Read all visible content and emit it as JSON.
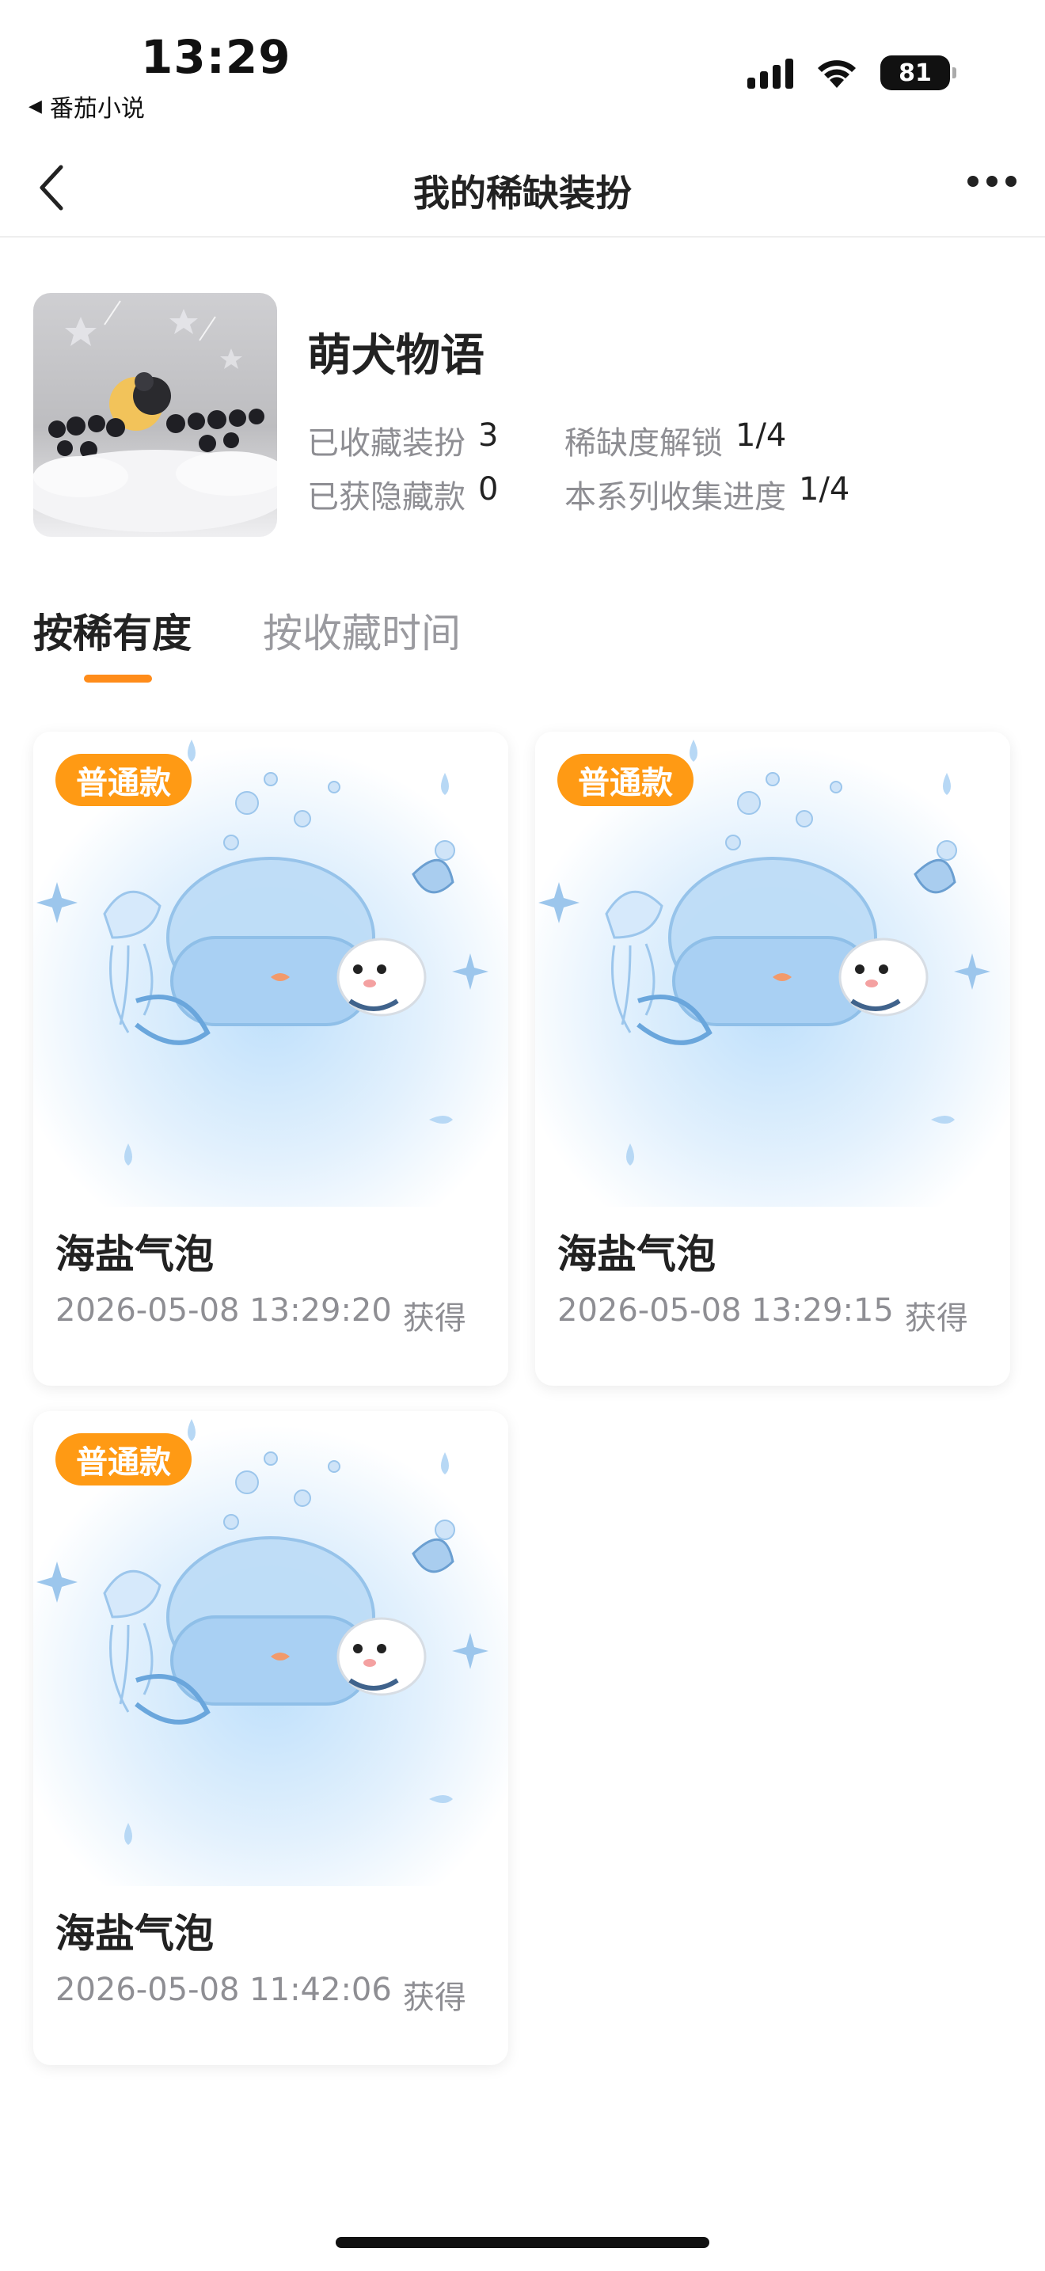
{
  "status_bar": {
    "time": "13:29",
    "back_app_label": "番茄小说",
    "battery": "81",
    "icons": [
      "cellular-signal-icon",
      "wifi-icon",
      "battery-icon"
    ]
  },
  "navbar": {
    "title": "我的稀缺装扮",
    "back_icon": "chevron-left-icon",
    "more_icon": "more-dots-icon"
  },
  "series": {
    "name": "萌犬物语",
    "stats": [
      {
        "label": "已收藏装扮",
        "value": "3"
      },
      {
        "label": "稀缺度解锁",
        "value": "1/4"
      },
      {
        "label": "已获隐藏款",
        "value": "0"
      },
      {
        "label": "本系列收集进度",
        "value": "1/4"
      }
    ]
  },
  "tabs": [
    {
      "label": "按稀有度",
      "active": true
    },
    {
      "label": "按收藏时间",
      "active": false
    }
  ],
  "accent_color": "#ff8c1a",
  "cards": [
    {
      "badge": "普通款",
      "name": "海盐气泡",
      "time": "2026-05-08 13:29:20",
      "suffix": "获得"
    },
    {
      "badge": "普通款",
      "name": "海盐气泡",
      "time": "2026-05-08 13:29:15",
      "suffix": "获得"
    },
    {
      "badge": "普通款",
      "name": "海盐气泡",
      "time": "2026-05-08 11:42:06",
      "suffix": "获得"
    }
  ]
}
